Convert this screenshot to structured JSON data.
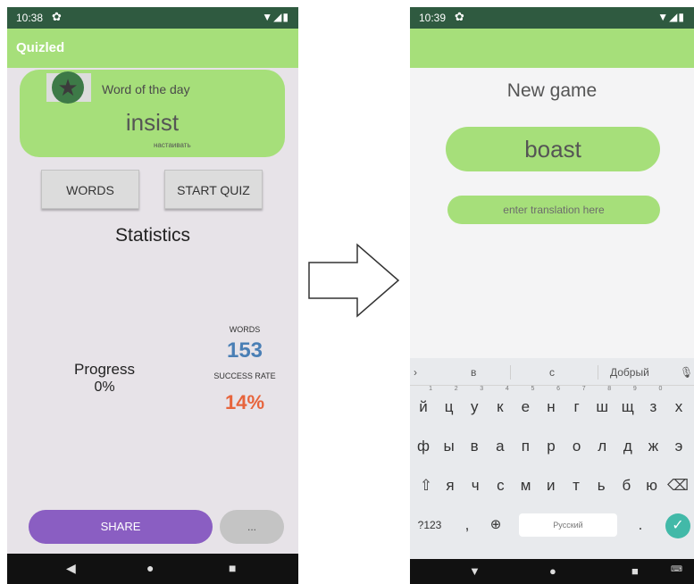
{
  "left_screen": {
    "status": {
      "time": "10:38"
    },
    "app_title": "Quizled",
    "word_of_day": {
      "label": "Word of the day",
      "word": "insist",
      "translation": "настаивать"
    },
    "buttons": {
      "words": "WORDS",
      "start_quiz": "START QUIZ"
    },
    "statistics": {
      "title": "Statistics",
      "progress_label": "Progress",
      "progress_value": "0%",
      "words_label": "WORDS",
      "words_count": "153",
      "success_label": "SUCCESS RATE",
      "success_value": "14%"
    },
    "share_label": "SHARE",
    "more_label": "..."
  },
  "right_screen": {
    "status": {
      "time": "10:39"
    },
    "title": "New game",
    "word": "boast",
    "answer_placeholder": "enter translation here",
    "keyboard": {
      "suggestions": [
        "в",
        "с",
        "Добрый"
      ],
      "row1": [
        "й",
        "ц",
        "у",
        "к",
        "е",
        "н",
        "г",
        "ш",
        "щ",
        "з",
        "х"
      ],
      "row1_hints": [
        "1",
        "2",
        "3",
        "4",
        "5",
        "6",
        "7",
        "8",
        "9",
        "0",
        ""
      ],
      "row2": [
        "ф",
        "ы",
        "в",
        "а",
        "п",
        "р",
        "о",
        "л",
        "д",
        "ж",
        "э"
      ],
      "row3": [
        "я",
        "ч",
        "с",
        "м",
        "и",
        "т",
        "ь",
        "б",
        "ю"
      ],
      "symbols_key": "?123",
      "comma_key": ",",
      "space_label": "Русский",
      "period_key": "."
    }
  },
  "colors": {
    "accent_green": "#a6df7a",
    "status_green": "#2f5a40",
    "share_purple": "#8a5ec2",
    "words_blue": "#4a7fb5",
    "rate_orange": "#e7643c"
  }
}
